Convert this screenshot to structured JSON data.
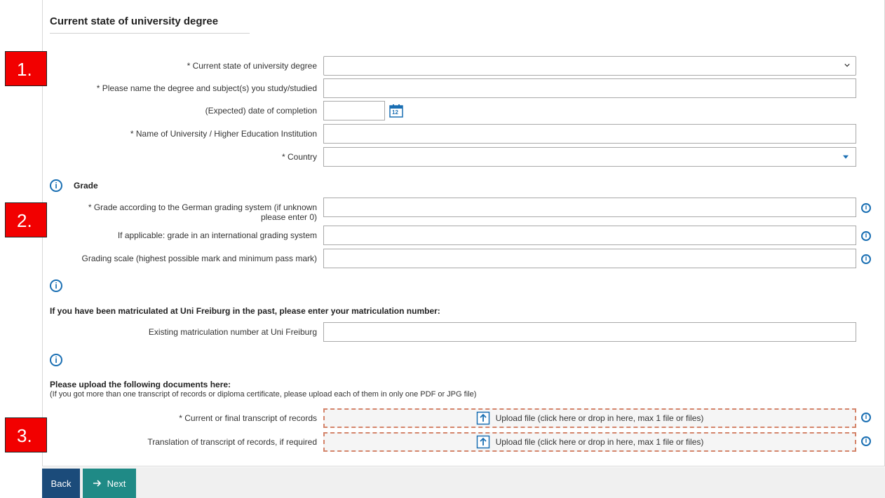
{
  "section": {
    "title": "Current state of university degree"
  },
  "markers": [
    "1.",
    "2.",
    "3."
  ],
  "fields": {
    "degree_state": {
      "label": "* Current state of university degree",
      "value": ""
    },
    "degree_subject": {
      "label": "* Please name the degree and subject(s) you study/studied",
      "value": ""
    },
    "completion_date": {
      "label": "(Expected) date of completion",
      "value": "",
      "calendar_day": "12"
    },
    "university_name": {
      "label": "* Name of University / Higher Education Institution",
      "value": ""
    },
    "country": {
      "label": "* Country",
      "value": ""
    }
  },
  "grade": {
    "heading": "Grade",
    "german_grade": {
      "label_line1": "* Grade according to the German grading system (if unknown",
      "label_line2": "please enter 0)",
      "value": ""
    },
    "international_grade": {
      "label": "If applicable: grade in an international grading system",
      "value": ""
    },
    "grading_scale": {
      "label": "Grading scale (highest possible mark and minimum pass mark)",
      "value": ""
    }
  },
  "matriculation": {
    "heading": "If you have been matriculated at Uni Freiburg in the past, please enter your matriculation number:",
    "label": "Existing matriculation number at Uni Freiburg",
    "value": ""
  },
  "uploads": {
    "heading": "Please upload the following documents here:",
    "note": "(If you got more than one transcript of records or diploma certificate, please upload each of them in only one PDF or JPG file)",
    "transcript": {
      "label": "* Current or final transcript of records",
      "text": "Upload file (click here or drop in here, max 1 file or files)"
    },
    "translation": {
      "label": "Translation of transcript of records, if required",
      "text": "Upload file (click here or drop in here, max 1 file or files)"
    }
  },
  "buttons": {
    "back": "Back",
    "next": "Next"
  },
  "colors": {
    "accent_blue": "#1a6fb3",
    "back_button": "#1b4b7a",
    "next_button": "#1f8a86",
    "marker_red": "#f20000",
    "upload_border": "#d4846a"
  }
}
